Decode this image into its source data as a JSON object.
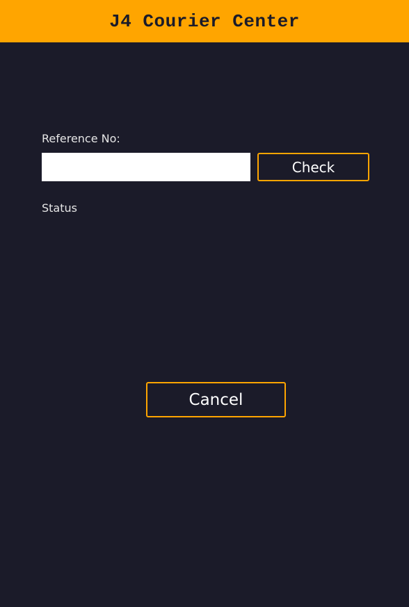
{
  "header": {
    "title": "J4 Courier Center"
  },
  "form": {
    "reference_label": "Reference No:",
    "reference_value": "",
    "reference_placeholder": "",
    "check_label": "Check",
    "status_label": "Status"
  },
  "actions": {
    "cancel_label": "Cancel"
  },
  "colors": {
    "accent": "#ffa500",
    "background": "#1b1b29",
    "text": "#e6e6e6"
  }
}
